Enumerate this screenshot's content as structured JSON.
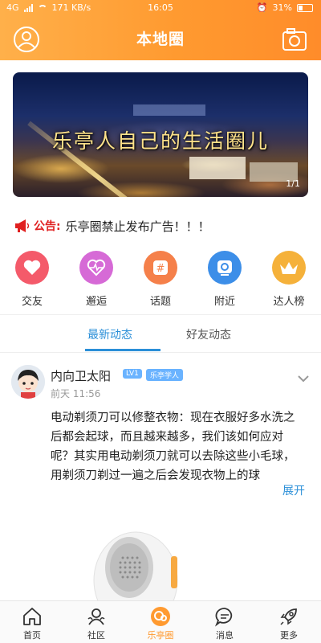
{
  "status": {
    "network": "4G",
    "speed": "171 KB/s",
    "time": "16:05",
    "battery": "31%"
  },
  "header": {
    "title": "本地圈"
  },
  "banner": {
    "caption": "乐亭人自己的生活圈儿",
    "page": "1/1"
  },
  "notice": {
    "label": "公告:",
    "text": "乐亭圈禁止发布广告！！！"
  },
  "categories": [
    {
      "label": "交友",
      "color": "#f45a6a",
      "icon": "heart-icon"
    },
    {
      "label": "邂逅",
      "color": "#d66ad6",
      "icon": "heartbeat-icon"
    },
    {
      "label": "话题",
      "color": "#f5804a",
      "icon": "hashtag-icon"
    },
    {
      "label": "附近",
      "color": "#3c8ee8",
      "icon": "location-icon"
    },
    {
      "label": "达人榜",
      "color": "#f5b13a",
      "icon": "crown-icon"
    }
  ],
  "tabs": {
    "latest": "最新动态",
    "friends": "好友动态"
  },
  "post": {
    "username": "内向卫太阳",
    "level": "LV1",
    "role": "乐亭学人",
    "time": "前天 11:56",
    "content": "电动剃须刀可以修整衣物：现在衣服好多水洗之后都会起球，而且越来越多，我们该如何应对呢？其实用电动剃须刀就可以去除这些小毛球，用剃须刀剃过一遍之后会发现衣物上的球",
    "expand": "展开"
  },
  "bottom_nav": [
    {
      "label": "首页",
      "icon": "home-icon"
    },
    {
      "label": "社区",
      "icon": "community-icon"
    },
    {
      "label": "乐亭圈",
      "icon": "circle-icon"
    },
    {
      "label": "消息",
      "icon": "message-icon"
    },
    {
      "label": "更多",
      "icon": "rocket-icon"
    }
  ],
  "colors": {
    "accent": "#ff9a30",
    "link": "#2b8fd8"
  }
}
